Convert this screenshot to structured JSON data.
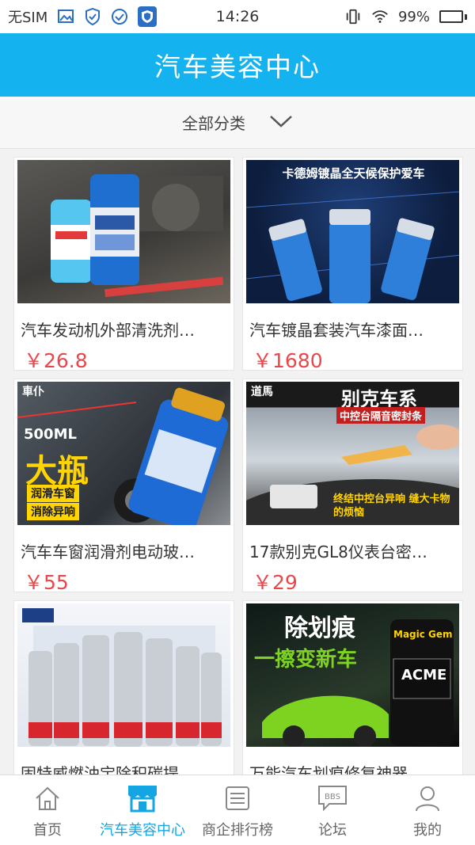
{
  "status_bar": {
    "carrier": "无SIM",
    "time": "14:26",
    "battery": "99%",
    "battery_level": 0.99
  },
  "header": {
    "title": "汽车美容中心"
  },
  "filter": {
    "label": "全部分类"
  },
  "products": [
    {
      "name": "汽车发动机外部清洗剂…",
      "price": "￥26.8"
    },
    {
      "name": "汽车镀晶套装汽车漆面…",
      "price": "￥1680"
    },
    {
      "name": "汽车车窗润滑剂电动玻…",
      "price": "￥55"
    },
    {
      "name": "17款别克GL8仪表台密…",
      "price": "￥29"
    },
    {
      "name": "固特威燃油宝除积碳提…",
      "price": ""
    },
    {
      "name": "万能汽车划痕修复神器…",
      "price": ""
    }
  ],
  "thumbs": {
    "p2_banner": "卡德姆镀晶全天候保护爱车",
    "p3_volume": "500ML",
    "p3_big": "大瓶",
    "p3_line1": "润滑车窗",
    "p3_line2": "消除异响",
    "p3_brand": "車仆",
    "p4_brand": "道馬",
    "p4_title": "别克车系",
    "p4_sub": "中控台隔音密封条",
    "p4_bottom": "终结中控台异响 缝大卡物的烦恼",
    "p6_title": "除划痕",
    "p6_sub": "一擦变新车",
    "p6_brand": "Magic Gem",
    "p6_label": "ACME"
  },
  "tabs": [
    {
      "label": "首页",
      "icon": "home-icon",
      "active": false
    },
    {
      "label": "汽车美容中心",
      "icon": "store-icon",
      "active": true
    },
    {
      "label": "商企排行榜",
      "icon": "list-icon",
      "active": false
    },
    {
      "label": "论坛",
      "icon": "bbs-icon",
      "active": false
    },
    {
      "label": "我的",
      "icon": "user-icon",
      "active": false
    }
  ],
  "colors": {
    "accent": "#14b3ef",
    "price": "#e8474c",
    "tab_active": "#14a5e3"
  }
}
